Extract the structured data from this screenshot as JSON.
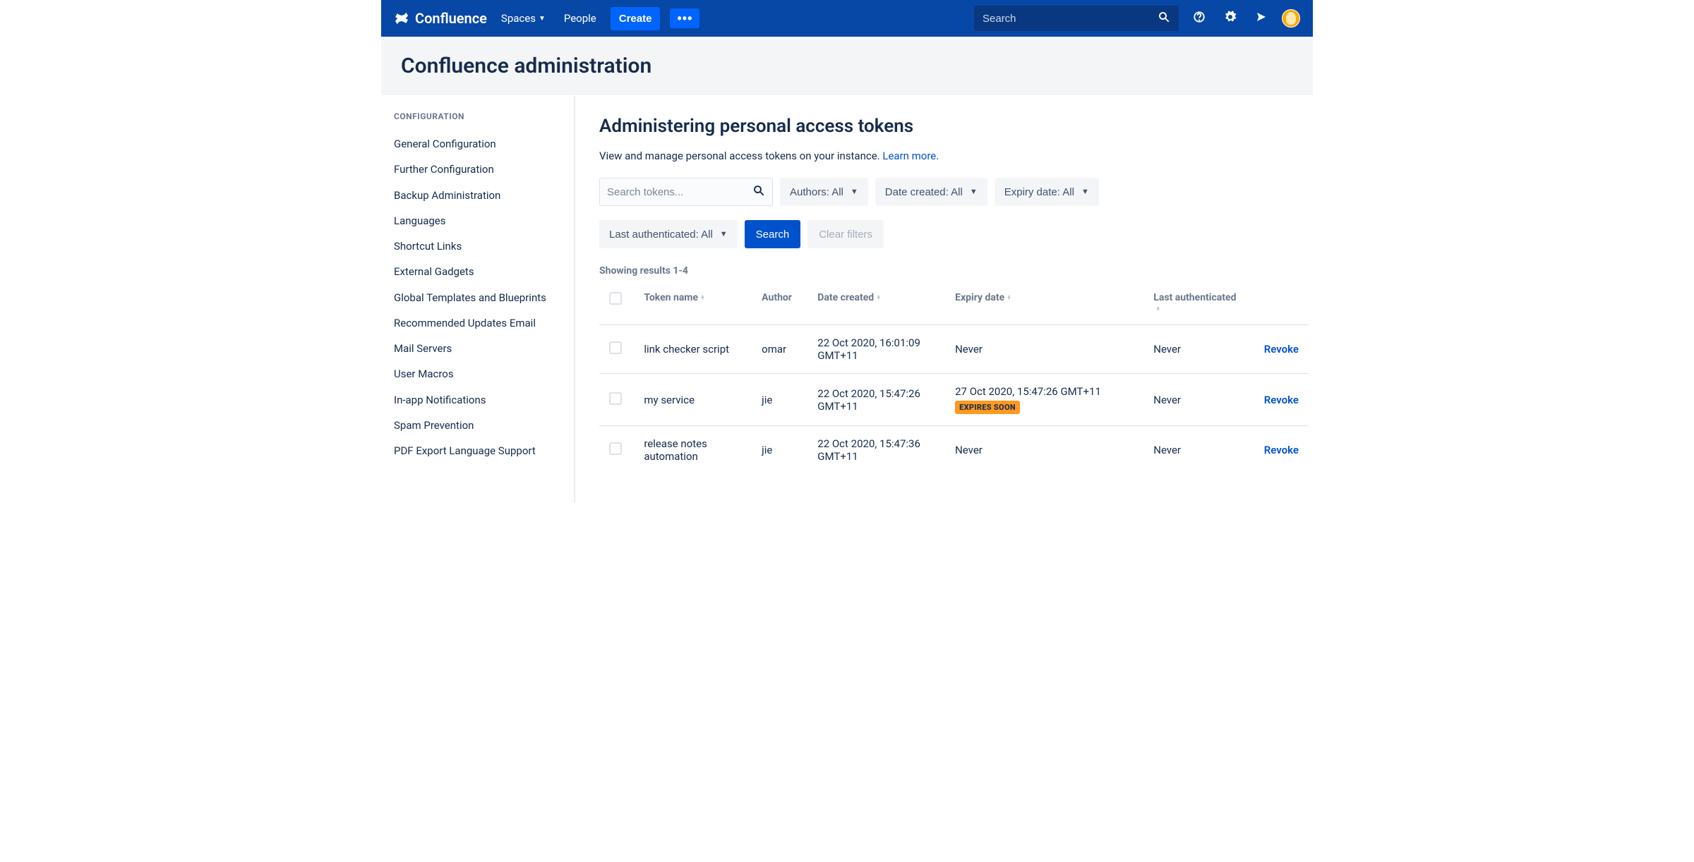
{
  "nav": {
    "product": "Confluence",
    "spaces": "Spaces",
    "people": "People",
    "create": "Create",
    "more": "•••",
    "search_placeholder": "Search"
  },
  "header": {
    "title": "Confluence administration"
  },
  "sidebar": {
    "section": "Configuration",
    "items": [
      "General Configuration",
      "Further Configuration",
      "Backup Administration",
      "Languages",
      "Shortcut Links",
      "External Gadgets",
      "Global Templates and Blueprints",
      "Recommended Updates Email",
      "Mail Servers",
      "User Macros",
      "In-app Notifications",
      "Spam Prevention",
      "PDF Export Language Support"
    ]
  },
  "main": {
    "title": "Administering personal access tokens",
    "desc": "View and manage personal access tokens on your instance. ",
    "learn_more": "Learn more",
    "period": ".",
    "search_tokens_placeholder": "Search tokens...",
    "filters": {
      "authors": "Authors: All",
      "created": "Date created: All",
      "expiry": "Expiry date: All",
      "lastauth": "Last authenticated: All"
    },
    "search_btn": "Search",
    "clear_btn": "Clear filters",
    "results": "Showing results 1-4",
    "columns": {
      "token": "Token name",
      "author": "Author",
      "created": "Date created",
      "expiry": "Expiry date",
      "lastauth": "Last authenticated"
    },
    "revoke_label": "Revoke",
    "expires_soon": "EXPIRES SOON",
    "rows": [
      {
        "name": "link checker script",
        "author": "omar",
        "created": "22 Oct 2020, 16:01:09 GMT+11",
        "expiry": "Never",
        "expires_soon": false,
        "lastauth": "Never"
      },
      {
        "name": "my service",
        "author": "jie",
        "created": "22 Oct 2020, 15:47:26 GMT+11",
        "expiry": "27 Oct 2020, 15:47:26 GMT+11",
        "expires_soon": true,
        "lastauth": "Never"
      },
      {
        "name": "release notes automation",
        "author": "jie",
        "created": "22 Oct 2020, 15:47:36 GMT+11",
        "expiry": "Never",
        "expires_soon": false,
        "lastauth": "Never"
      }
    ]
  }
}
